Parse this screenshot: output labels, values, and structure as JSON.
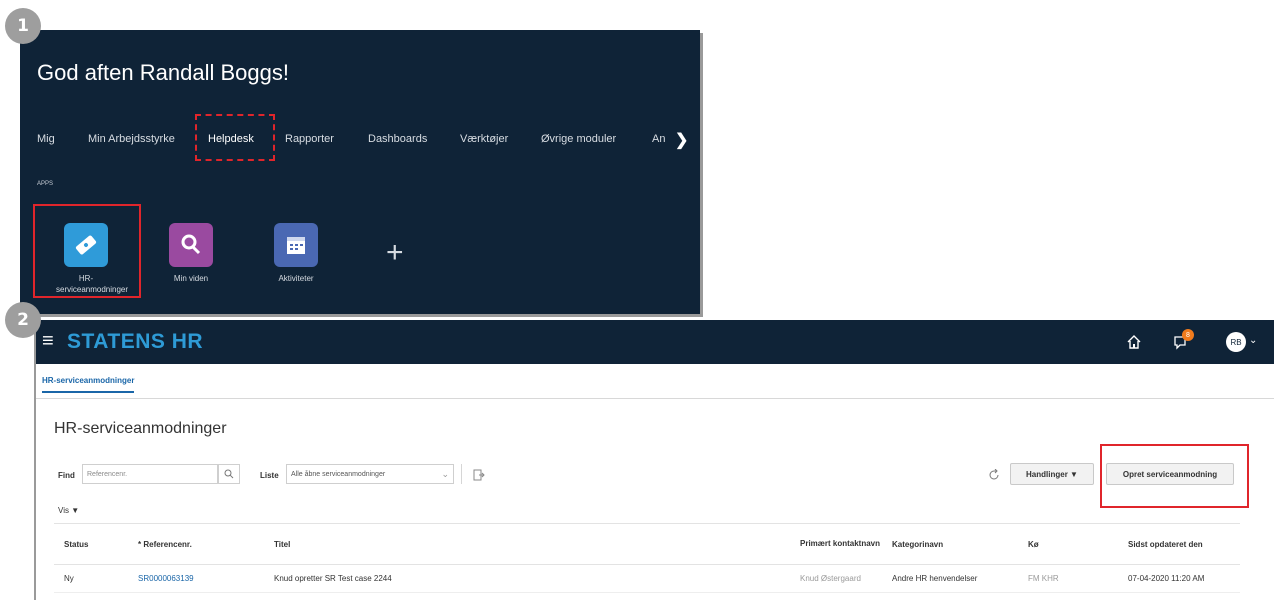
{
  "badges": [
    "1",
    "2"
  ],
  "panel1": {
    "greeting": "God aften Randall Boggs!",
    "nav": [
      "Mig",
      "Min Arbejdsstyrke",
      "Helpdesk",
      "Rapporter",
      "Dashboards",
      "Værktøjer",
      "Øvrige moduler",
      "An"
    ],
    "apps_label": "APPS",
    "apps": [
      {
        "label": "HR-\nserviceanmodninger",
        "icon": "ticket-icon",
        "color": "#2f9bd9"
      },
      {
        "label": "Min viden",
        "icon": "magnifier-icon",
        "color": "#9a4aa0"
      },
      {
        "label": "Aktiviteter",
        "icon": "calendar-icon",
        "color": "#4a68b3"
      }
    ],
    "add_label": "+"
  },
  "panel2": {
    "brand": "STATENS HR",
    "notification_count": "8",
    "avatar": "RB",
    "tab": "HR-serviceanmodninger",
    "page_title": "HR-serviceanmodninger",
    "find_label": "Find",
    "find_placeholder": "Referencenr.",
    "list_label": "Liste",
    "list_value": "Alle åbne serviceanmodninger",
    "actions_label": "Handlinger ▼",
    "create_label": "Opret serviceanmodning",
    "view_label": "Vis ▼",
    "columns": [
      "Status",
      "* Referencenr.",
      "Titel",
      "Primært kontaktnavn",
      "Kategorinavn",
      "Kø",
      "Sidst opdateret den"
    ],
    "rows": [
      {
        "status": "Ny",
        "ref": "SR0000063139",
        "title": "Knud opretter SR Test case 2244",
        "contact": "Knud Østergaard",
        "category": "Andre HR henvendelser",
        "queue": "FM KHR",
        "updated": "07-04-2020 11:20 AM"
      }
    ]
  },
  "colors": {
    "dark_navy": "#0f2337",
    "highlight_red": "#e0252b",
    "brand_blue": "#2e9bd6",
    "link_blue": "#1a66a8"
  }
}
